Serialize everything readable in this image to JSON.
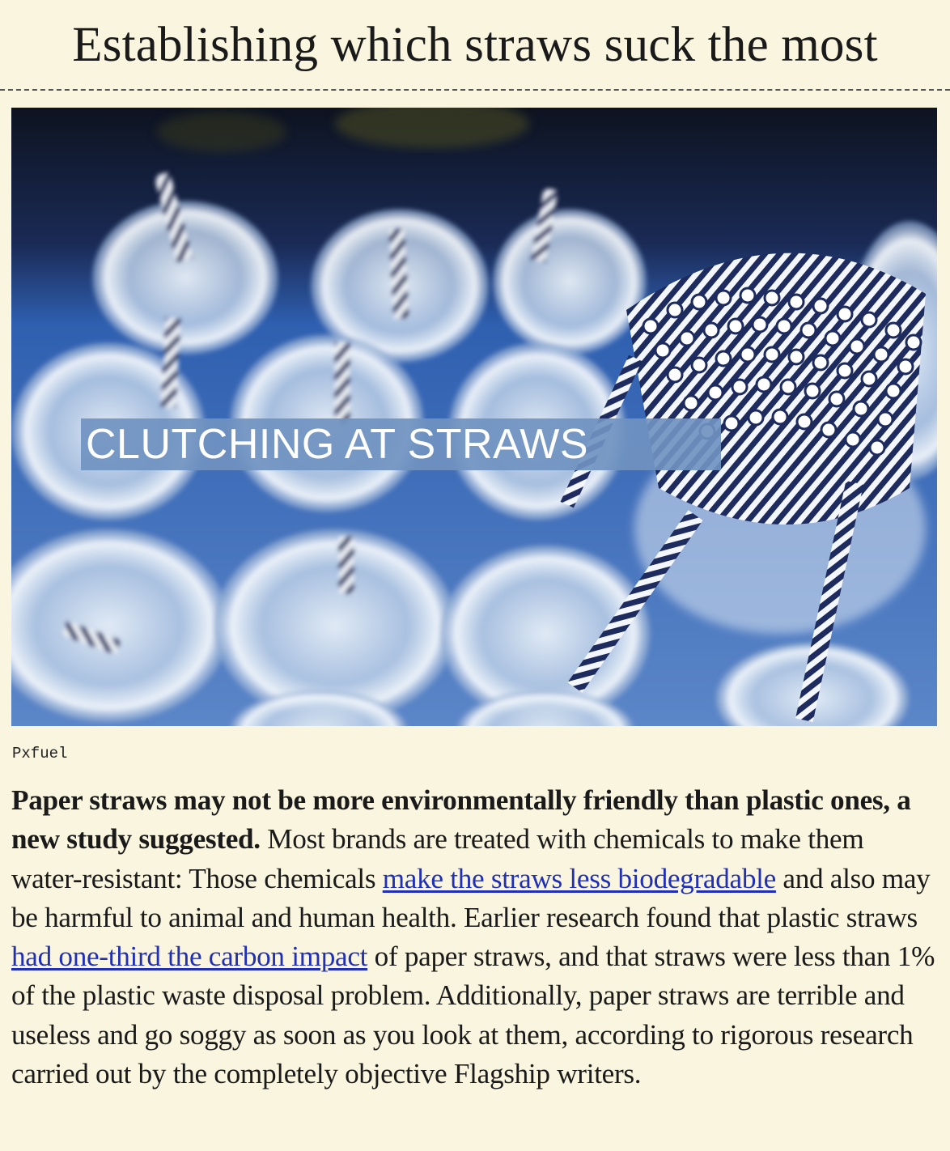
{
  "article": {
    "headline": "Establishing which straws suck the most",
    "image": {
      "overlay_caption": "CLUTCHING AT STRAWS",
      "credit": "Pxfuel"
    },
    "lead_bold": "Paper straws may not be more environmentally friendly than plastic ones, a new study suggested.",
    "text_1": " Most brands are treated with chemicals to make them water-resistant: Those chemicals ",
    "link_1": "make the straws less biodegradable",
    "text_2": " and also may be harmful to animal and human health. Earlier research found that plastic straws ",
    "link_2": "had one-third the carbon impact",
    "text_3": " of paper straws, and that straws were less than 1% of the plastic waste disposal problem. Additionally, paper straws are terrible and useless and go soggy as soon as you look at them, according to rigorous research carried out by the completely objective Flagship writers."
  },
  "colors": {
    "background": "#faf5de",
    "link": "#1f2fb8",
    "straw_stripe": "#1d2b5e",
    "overlay_band": "#7092c0"
  }
}
